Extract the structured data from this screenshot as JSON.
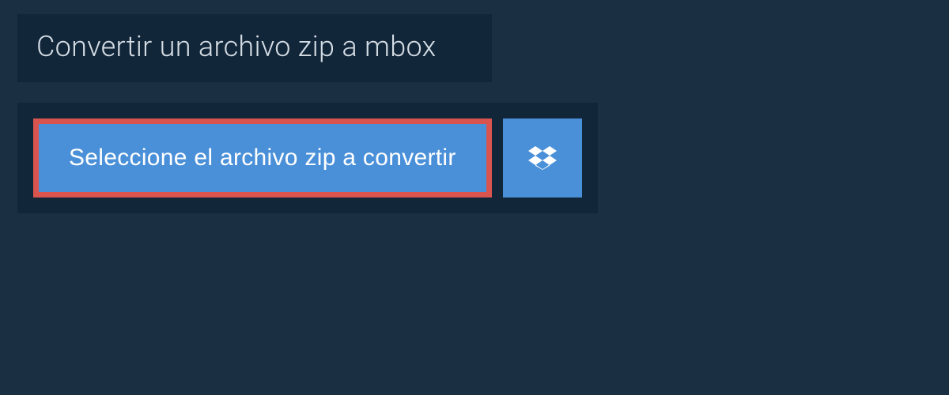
{
  "header": {
    "title": "Convertir un archivo zip a mbox"
  },
  "actions": {
    "select_file_label": "Seleccione el archivo zip a convertir",
    "dropbox_icon": "dropbox-icon"
  },
  "colors": {
    "page_background": "#1a2f42",
    "panel_background": "#12263a",
    "button_background": "#4a90d9",
    "highlight_border": "#d9544f",
    "text_light": "#d5dde4",
    "text_white": "#ffffff"
  }
}
